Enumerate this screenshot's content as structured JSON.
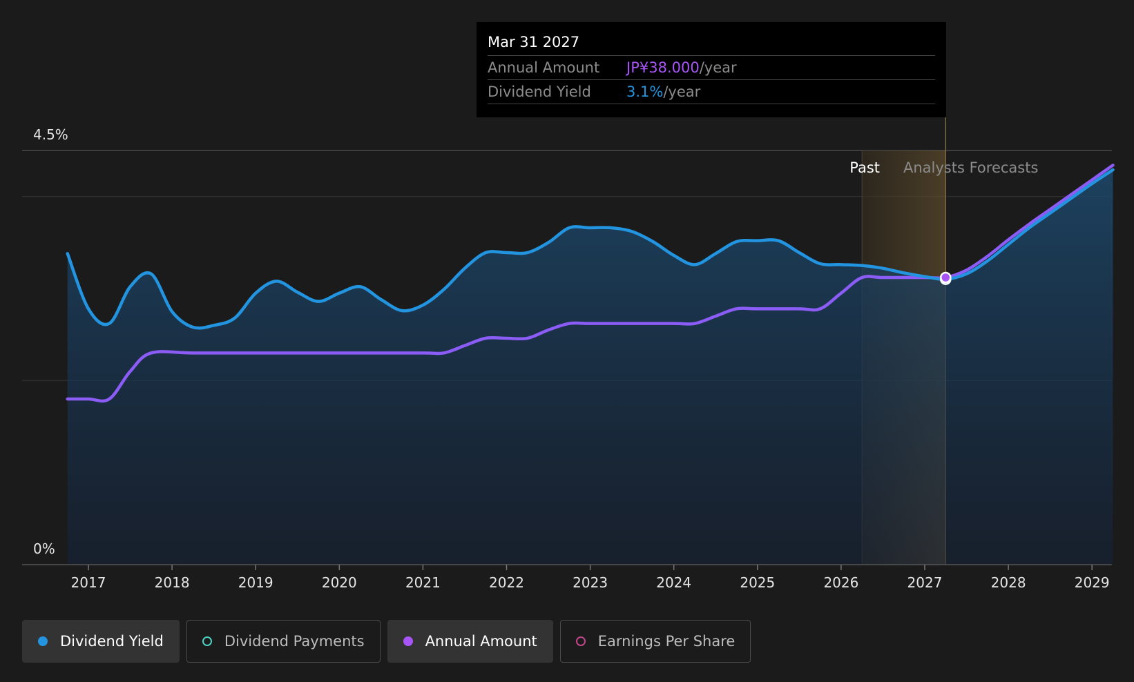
{
  "chart_data": {
    "type": "area",
    "x_ticks": [
      "2017",
      "2018",
      "2019",
      "2020",
      "2021",
      "2022",
      "2023",
      "2024",
      "2025",
      "2026",
      "2027",
      "2028",
      "2029"
    ],
    "y_ticks": [
      "0%",
      "4.5%"
    ],
    "ylim": [
      0,
      4.5
    ],
    "xlim": [
      2016.5,
      2029.25
    ],
    "past_label": "Past",
    "forecast_label": "Analysts Forecasts",
    "past_end": 2026.25,
    "forecast_start": 2027.25,
    "series": [
      {
        "name": "Dividend Yield",
        "color": "#2394df",
        "points": [
          [
            2016.75,
            3.38
          ],
          [
            2017.0,
            2.78
          ],
          [
            2017.25,
            2.62
          ],
          [
            2017.5,
            3.02
          ],
          [
            2017.75,
            3.16
          ],
          [
            2018.0,
            2.75
          ],
          [
            2018.25,
            2.58
          ],
          [
            2018.5,
            2.6
          ],
          [
            2018.75,
            2.68
          ],
          [
            2019.0,
            2.95
          ],
          [
            2019.25,
            3.08
          ],
          [
            2019.5,
            2.96
          ],
          [
            2019.75,
            2.86
          ],
          [
            2020.0,
            2.95
          ],
          [
            2020.25,
            3.02
          ],
          [
            2020.5,
            2.88
          ],
          [
            2020.75,
            2.76
          ],
          [
            2021.0,
            2.82
          ],
          [
            2021.25,
            2.99
          ],
          [
            2021.5,
            3.22
          ],
          [
            2021.75,
            3.39
          ],
          [
            2022.0,
            3.39
          ],
          [
            2022.25,
            3.39
          ],
          [
            2022.5,
            3.5
          ],
          [
            2022.75,
            3.66
          ],
          [
            2023.0,
            3.66
          ],
          [
            2023.25,
            3.66
          ],
          [
            2023.5,
            3.62
          ],
          [
            2023.75,
            3.51
          ],
          [
            2024.0,
            3.36
          ],
          [
            2024.25,
            3.26
          ],
          [
            2024.5,
            3.38
          ],
          [
            2024.75,
            3.51
          ],
          [
            2025.0,
            3.52
          ],
          [
            2025.25,
            3.52
          ],
          [
            2025.5,
            3.39
          ],
          [
            2025.75,
            3.27
          ],
          [
            2026.0,
            3.26
          ],
          [
            2026.25,
            3.25
          ],
          [
            2026.5,
            3.22
          ],
          [
            2026.75,
            3.17
          ],
          [
            2027.0,
            3.13
          ],
          [
            2027.25,
            3.1
          ],
          [
            2027.5,
            3.16
          ],
          [
            2027.75,
            3.3
          ],
          [
            2028.0,
            3.48
          ],
          [
            2028.25,
            3.66
          ],
          [
            2028.5,
            3.82
          ],
          [
            2028.75,
            3.98
          ],
          [
            2029.0,
            4.14
          ],
          [
            2029.25,
            4.29
          ]
        ]
      },
      {
        "name": "Annual Amount",
        "color": "#8b5cf6",
        "points": [
          [
            2016.75,
            1.8
          ],
          [
            2017.0,
            1.8
          ],
          [
            2017.25,
            1.8
          ],
          [
            2017.5,
            2.1
          ],
          [
            2017.75,
            2.3
          ],
          [
            2018.25,
            2.3
          ],
          [
            2019.0,
            2.3
          ],
          [
            2020.0,
            2.3
          ],
          [
            2021.0,
            2.3
          ],
          [
            2021.25,
            2.3
          ],
          [
            2021.5,
            2.38
          ],
          [
            2021.75,
            2.46
          ],
          [
            2022.0,
            2.46
          ],
          [
            2022.25,
            2.46
          ],
          [
            2022.5,
            2.55
          ],
          [
            2022.75,
            2.62
          ],
          [
            2023.0,
            2.62
          ],
          [
            2023.5,
            2.62
          ],
          [
            2024.0,
            2.62
          ],
          [
            2024.25,
            2.62
          ],
          [
            2024.5,
            2.7
          ],
          [
            2024.75,
            2.78
          ],
          [
            2025.0,
            2.78
          ],
          [
            2025.5,
            2.78
          ],
          [
            2025.75,
            2.78
          ],
          [
            2026.0,
            2.95
          ],
          [
            2026.25,
            3.12
          ],
          [
            2026.5,
            3.12
          ],
          [
            2027.0,
            3.12
          ],
          [
            2027.25,
            3.12
          ],
          [
            2027.5,
            3.2
          ],
          [
            2027.75,
            3.35
          ],
          [
            2028.0,
            3.53
          ],
          [
            2028.25,
            3.7
          ],
          [
            2028.5,
            3.86
          ],
          [
            2028.75,
            4.02
          ],
          [
            2029.0,
            4.18
          ],
          [
            2029.25,
            4.34
          ]
        ]
      }
    ],
    "highlight_x": 2027.25,
    "highlight_yield": 3.1,
    "highlight_amount": 3.12
  },
  "tooltip": {
    "date": "Mar 31 2027",
    "annual_amount_label": "Annual Amount",
    "annual_amount_value": "JP¥38.000",
    "annual_amount_unit": "/year",
    "yield_label": "Dividend Yield",
    "yield_value": "3.1%",
    "yield_unit": "/year"
  },
  "legend": [
    {
      "label": "Dividend Yield",
      "color": "#2394df",
      "active": true,
      "filled": true
    },
    {
      "label": "Dividend Payments",
      "color": "#4fd1c5",
      "active": false,
      "filled": false
    },
    {
      "label": "Annual Amount",
      "color": "#a855f7",
      "active": true,
      "filled": true
    },
    {
      "label": "Earnings Per Share",
      "color": "#c0488a",
      "active": false,
      "filled": false
    }
  ]
}
